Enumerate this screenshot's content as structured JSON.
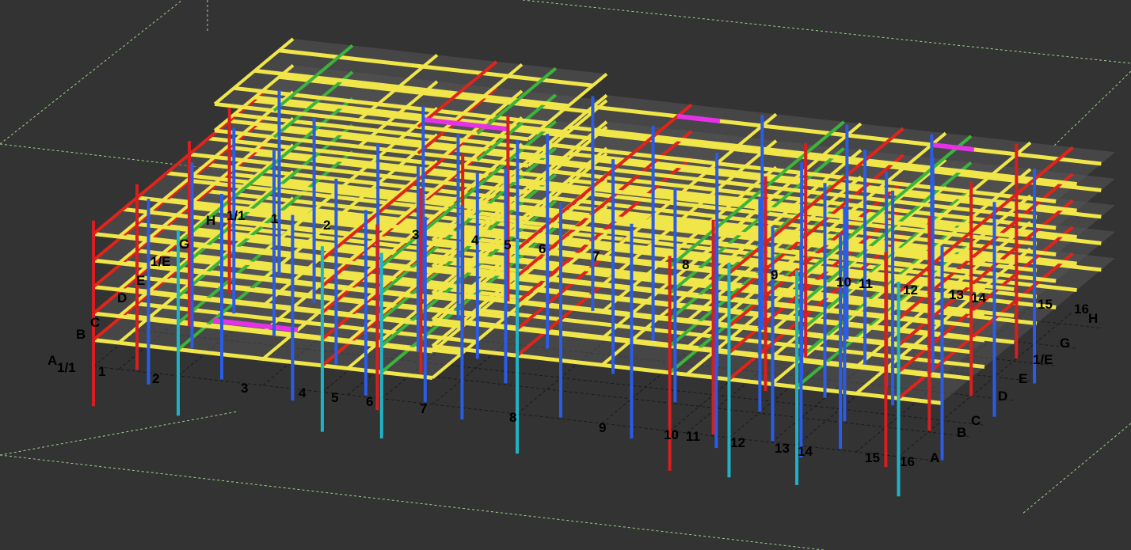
{
  "viewport": {
    "background": "#333333",
    "bounding_box_color": "#9bd38a"
  },
  "colors": {
    "beam_yellow": "#f0e64a",
    "beam_red": "#e0241a",
    "beam_magenta": "#e632e6",
    "beam_green": "#3cb43c",
    "column_blue": "#2a5ce6",
    "column_cyan": "#1eb4c8",
    "column_red": "#d81e1e",
    "slab_gray": "#555555",
    "grid_line": "#1a1a1a"
  },
  "grid_labels": {
    "numbers": [
      "1/1",
      "1",
      "2",
      "3",
      "4",
      "5",
      "6",
      "7",
      "8",
      "9",
      "10",
      "11",
      "12",
      "13",
      "14",
      "15",
      "16"
    ],
    "letters": [
      "A",
      "B",
      "C",
      "D",
      "E",
      "1/E",
      "G",
      "H"
    ]
  }
}
